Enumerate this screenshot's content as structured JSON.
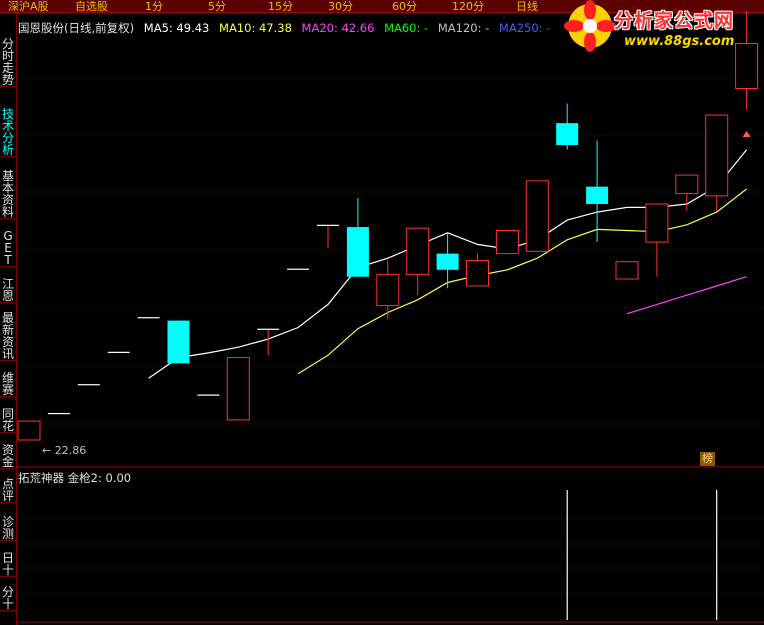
{
  "topbar": {
    "tabs": [
      {
        "label": "深沪A股"
      },
      {
        "label": "自选股"
      },
      {
        "label": "1分"
      },
      {
        "label": "5分"
      },
      {
        "label": "15分"
      },
      {
        "label": "30分"
      },
      {
        "label": "60分"
      },
      {
        "label": "120分"
      },
      {
        "label": "日线"
      }
    ]
  },
  "sidebar": {
    "items": [
      {
        "label": "分时走势"
      },
      {
        "label": "技术分析"
      },
      {
        "label": "基本资料"
      },
      {
        "label": "GET"
      },
      {
        "label": "江恩"
      },
      {
        "label": "最新资讯"
      },
      {
        "label": "维赛"
      },
      {
        "label": "同花"
      },
      {
        "label": "资金"
      },
      {
        "label": "点评"
      },
      {
        "label": "诊测"
      },
      {
        "label": "日十"
      },
      {
        "label": "分十"
      }
    ]
  },
  "info": {
    "stock": "国恩股份(日线,前复权)",
    "ma5": "MA5: 49.43",
    "ma10": "MA10: 47.38",
    "ma20": "MA20: 42.66",
    "ma60": "MA60: -",
    "ma120": "MA120: -",
    "ma250": "MA250: -"
  },
  "colors": {
    "up": "#ff3030",
    "down": "#00ffff",
    "ma5": "#ffffff",
    "ma10": "#ffff40",
    "ma20": "#ff40ff",
    "ma60": "#00ff00",
    "ma120": "#c0c0c0",
    "ma250": "#4060ff"
  },
  "indicator": {
    "label": "拓荒神器 金枪2: 0.00"
  },
  "low_label": "← 22.86",
  "corner_badge": "榜",
  "logo": {
    "title": "分析家公式网",
    "url": "www.88gs.com"
  },
  "chart_data": {
    "type": "candlestick",
    "min_price": 22.86,
    "candles": [
      {
        "o": 22.86,
        "c": 24.5,
        "h": 24.5,
        "l": 22.86
      },
      {
        "o": 25.2,
        "c": 25.2,
        "h": 25.2,
        "l": 25.2
      },
      {
        "o": 27.7,
        "c": 27.7,
        "h": 27.7,
        "l": 27.7
      },
      {
        "o": 30.5,
        "c": 30.5,
        "h": 30.5,
        "l": 30.5
      },
      {
        "o": 33.5,
        "c": 33.5,
        "h": 33.5,
        "l": 33.5
      },
      {
        "o": 33.2,
        "c": 29.5,
        "h": 33.2,
        "l": 29.5
      },
      {
        "o": 26.8,
        "c": 26.8,
        "h": 26.8,
        "l": 26.8
      },
      {
        "o": 24.6,
        "c": 30.0,
        "h": 30.0,
        "l": 24.6
      },
      {
        "o": 32.5,
        "c": 32.5,
        "h": 32.5,
        "l": 30.2
      },
      {
        "o": 37.7,
        "c": 37.7,
        "h": 37.7,
        "l": 37.7
      },
      {
        "o": 41.5,
        "c": 41.5,
        "h": 41.5,
        "l": 39.5
      },
      {
        "o": 41.3,
        "c": 37.0,
        "h": 43.8,
        "l": 37.0
      },
      {
        "o": 34.5,
        "c": 37.2,
        "h": 38.4,
        "l": 33.3
      },
      {
        "o": 37.2,
        "c": 41.2,
        "h": 41.2,
        "l": 35.4
      },
      {
        "o": 39.0,
        "c": 37.6,
        "h": 40.8,
        "l": 36.0
      },
      {
        "o": 36.2,
        "c": 38.4,
        "h": 39.0,
        "l": 36.2
      },
      {
        "o": 39.0,
        "c": 41.0,
        "h": 41.0,
        "l": 39.0
      },
      {
        "o": 39.2,
        "c": 45.3,
        "h": 45.3,
        "l": 39.2
      },
      {
        "o": 50.3,
        "c": 48.4,
        "h": 52.0,
        "l": 48.0
      },
      {
        "o": 44.8,
        "c": 43.3,
        "h": 48.8,
        "l": 40.0
      },
      {
        "o": 36.8,
        "c": 38.3,
        "h": 38.3,
        "l": 36.8
      },
      {
        "o": 40.0,
        "c": 43.3,
        "h": 43.3,
        "l": 37.0
      },
      {
        "o": 44.2,
        "c": 45.8,
        "h": 45.8,
        "l": 42.7
      },
      {
        "o": 44.0,
        "c": 51.0,
        "h": 51.0,
        "l": 42.7
      },
      {
        "o": 53.3,
        "c": 57.2,
        "h": 60.0,
        "l": 51.5
      }
    ],
    "ma5": [
      null,
      null,
      null,
      null,
      28.2,
      30.0,
      30.4,
      30.9,
      31.6,
      32.6,
      34.6,
      37.8,
      38.6,
      39.7,
      40.8,
      39.8,
      39.4,
      40.2,
      41.9,
      42.6,
      43.0,
      43.0,
      43.3,
      44.8,
      48.0
    ],
    "ma10": [
      null,
      null,
      null,
      null,
      null,
      null,
      null,
      null,
      null,
      28.6,
      30.2,
      32.5,
      33.9,
      35.0,
      36.5,
      37.1,
      37.6,
      38.6,
      40.2,
      41.1,
      41.0,
      40.9,
      41.5,
      42.6,
      44.6
    ],
    "ma20": [
      null,
      null,
      null,
      null,
      null,
      null,
      null,
      null,
      null,
      null,
      null,
      null,
      null,
      null,
      null,
      null,
      null,
      null,
      null,
      null,
      33.8,
      34.6,
      35.4,
      36.2,
      37.0
    ],
    "signals": [
      {
        "index": 18,
        "value": 1
      },
      {
        "index": 23,
        "value": 1
      }
    ]
  }
}
